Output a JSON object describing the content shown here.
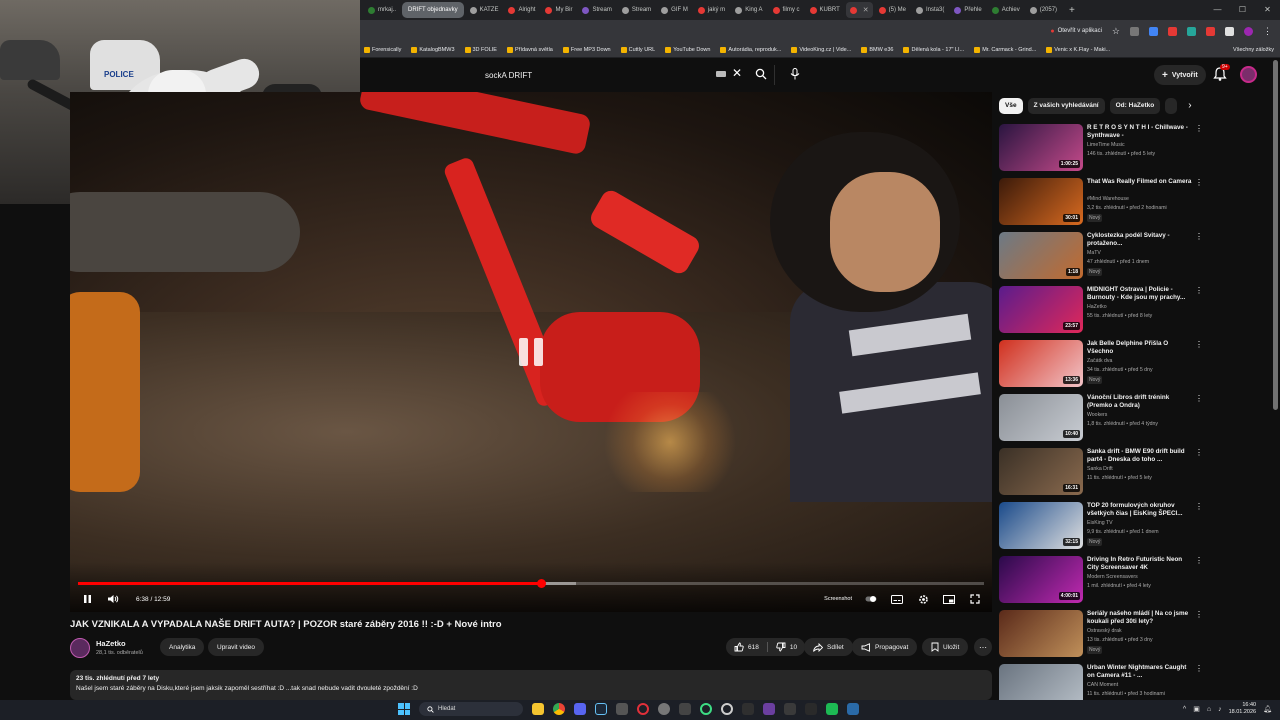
{
  "browser": {
    "tabs": [
      {
        "label": "mrkaj..",
        "color": "#2e7d32"
      },
      {
        "label": "DRIFT objednavky",
        "group": true
      },
      {
        "label": "KATZE",
        "color": "#9e9e9e"
      },
      {
        "label": "Alright",
        "color": "#e53935"
      },
      {
        "label": "My Bir",
        "color": "#e53935"
      },
      {
        "label": "Stream",
        "color": "#7e57c2"
      },
      {
        "label": "Stream",
        "color": "#9e9e9e"
      },
      {
        "label": "GIF M",
        "color": "#9e9e9e"
      },
      {
        "label": "jaký m",
        "color": "#e53935"
      },
      {
        "label": "King A",
        "color": "#9e9e9e"
      },
      {
        "label": "filmy c",
        "color": "#e53935"
      },
      {
        "label": "KUBRT",
        "color": "#e53935"
      },
      {
        "label": "",
        "color": "#e53935",
        "active": true
      },
      {
        "label": "(5) Me",
        "color": "#e53935"
      },
      {
        "label": "Insta3(",
        "color": "#9e9e9e"
      },
      {
        "label": "Přehle",
        "color": "#7e57c2"
      },
      {
        "label": "Achiev",
        "color": "#2e7d32"
      },
      {
        "label": "(2057)",
        "color": "#9e9e9e"
      }
    ],
    "open_in_app": "Otevřít v aplikaci",
    "bookmarks": [
      "Forensically",
      "KatalogBMW3",
      "3D FOLIE",
      "Přídavná světla",
      "Free MP3 Down",
      "Cuttly URL",
      "YouTube Down",
      "Autorádia, reproduk...",
      "VideoKing.cz | Vide...",
      "BMW e36",
      "Dělená kola - 17\" LI...",
      "Mr. Carmack - Grind...",
      "Venic x K.Flay - Maki..."
    ],
    "all_bookmarks": "Všechny záložky"
  },
  "youtube": {
    "search_query": "sockA DRIFT",
    "create_label": "Vytvořit",
    "notif_count": "9+"
  },
  "player": {
    "time": "6:38 / 12:59",
    "progress": 0.511,
    "buffered": 0.55,
    "screenshot_label": "Screenshot"
  },
  "video": {
    "title": "JAK VZNIKALA A VYPADALA NAŠE DRIFT AUTA? | POZOR staré záběry 2016 !! :-D + Nové intro",
    "channel": "HaZetko",
    "subscribers": "28,1 tis. odběratelů",
    "analytics_label": "Analytika",
    "edit_label": "Upravit video",
    "likes": "618",
    "dislikes": "10",
    "share_label": "Sdílet",
    "promote_label": "Propagovat",
    "save_label": "Uložit",
    "desc_meta": "23 tis. zhlédnutí  před 7 lety",
    "desc_text": "Našel jsem staré záběry na Disku,které jsem jaksik zapoměl sestříhat :D ...tak snad nebude vadit dvouleté zpoždění :D"
  },
  "sidebar": {
    "chips": [
      "Vše",
      "Z vašich vyhledávání",
      "Od: HaZetko"
    ],
    "recs": [
      {
        "title": "R E T R O S Y N T H I - Chillwave - Synthwave -",
        "channel": "LimeTime Music",
        "meta": "146 tis. zhlédnutí • před 5 lety",
        "dur": "1:00:25",
        "new": "",
        "c1": "#2a1540",
        "c2": "#c44a8a"
      },
      {
        "title": "That Was Really Filmed on Camera",
        "channel": "#Mind Warehouse",
        "meta": "3,2 tis. zhlédnutí • před 2 hodinami",
        "dur": "30:01",
        "new": "Nový",
        "c1": "#3b1a0a",
        "c2": "#d86a20"
      },
      {
        "title": "Cyklostezka podél Svitavy - protaženo...",
        "channel": "MaTV",
        "meta": "47 zhlédnutí • před 1 dnem",
        "dur": "1:18",
        "new": "Nový",
        "c1": "#6c7a86",
        "c2": "#c26a2e"
      },
      {
        "title": "MIDNIGHT Ostrava | Policie - Burnouty - Kde jsou my prachy...",
        "channel": "HaZetko",
        "meta": "55 tis. zhlédnutí • před 8 lety",
        "dur": "23:57",
        "new": "",
        "c1": "#5a1c8c",
        "c2": "#e0285a"
      },
      {
        "title": "Jak Belle Delphine Přišla O Všechno",
        "channel": "Začátk dva",
        "meta": "34 tis. zhlédnutí • před 5 dny",
        "dur": "13:36",
        "new": "Nový",
        "c1": "#d0301e",
        "c2": "#f2c4c8"
      },
      {
        "title": "Vánoční Libros drift trénink (Premko a Ondra)",
        "channel": "Wookers",
        "meta": "1,8 tis. zhlédnutí • před 4 týdny",
        "dur": "10:40",
        "new": "",
        "c1": "#8a8f96",
        "c2": "#c8ccd2"
      },
      {
        "title": "Sanka drift - BMW E90 drift build part4 - Dneska do toho ...",
        "channel": "Sanka Drift",
        "meta": "11 tis. zhlédnutí • před 5 lety",
        "dur": "16:31",
        "new": "",
        "c1": "#3a3026",
        "c2": "#8a6a4e"
      },
      {
        "title": "TOP 20 formulových okruhov všetkých čias | EisKing ŠPECI...",
        "channel": "EisKing TV",
        "meta": "9,9 tis. zhlédnutí • před 1 dnem",
        "dur": "32:15",
        "new": "Nový",
        "c1": "#1a4a8a",
        "c2": "#e0e0e0"
      },
      {
        "title": "Driving In Retro Futuristic Neon City Screensaver 4K",
        "channel": "Modern Screensavers",
        "meta": "1 mil. zhlédnutí • před 4 lety",
        "dur": "4:00:01",
        "new": "",
        "c1": "#2a0a4a",
        "c2": "#c02ab0"
      },
      {
        "title": "Seriály našeho mládí | Na co jsme koukali před 30ti lety?",
        "channel": "Ostravský drak",
        "meta": "13 tis. zhlédnutí • před 3 dny",
        "dur": "",
        "new": "Nový",
        "c1": "#5a2a1a",
        "c2": "#c0905a"
      },
      {
        "title": "Urban Winter Nightmares Caught on Camera #11 - ...",
        "channel": "CAN Moment",
        "meta": "11 tis. zhlédnutí • před 3 hodinami",
        "dur": "32:07",
        "new": "",
        "c1": "#6a7480",
        "c2": "#b8c0c8"
      }
    ]
  },
  "taskbar": {
    "search_label": "Hledat",
    "time": "16:40",
    "date": "18.01.2026"
  }
}
